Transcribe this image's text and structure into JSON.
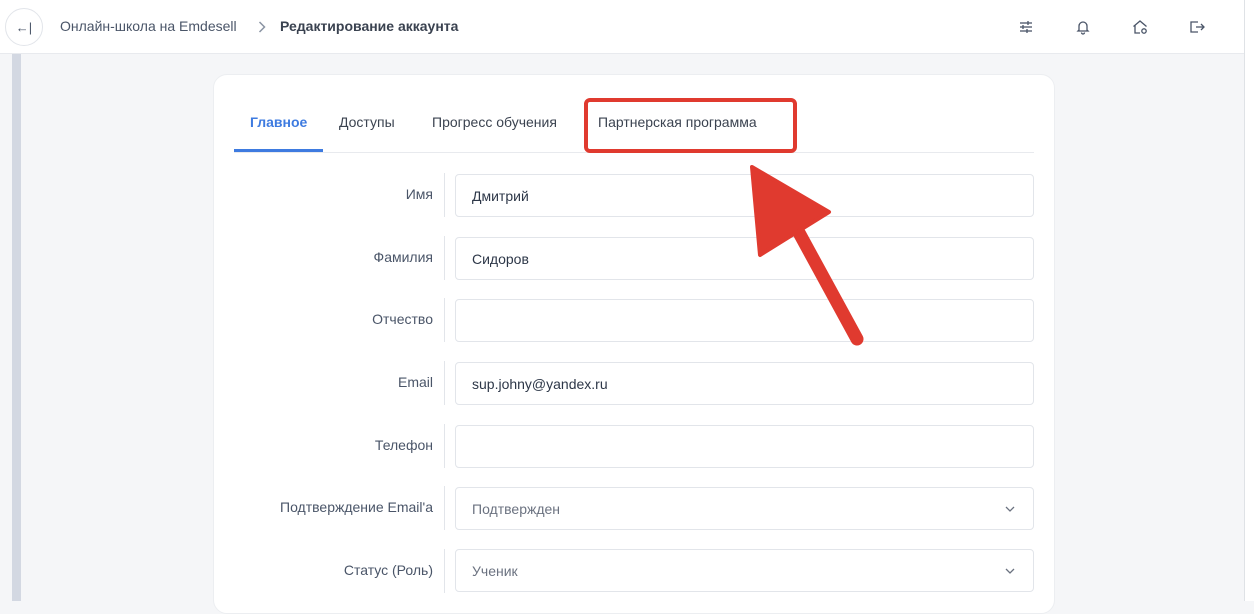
{
  "header": {
    "collapse_glyph": "←|",
    "breadcrumb": {
      "school": "Онлайн-школа на Emdesell",
      "current": "Редактирование аккаунта"
    },
    "icons": [
      "sliders-icon",
      "bell-icon",
      "home-settings-icon",
      "logout-icon"
    ]
  },
  "tabs": [
    {
      "label": "Главное",
      "active": true
    },
    {
      "label": "Доступы",
      "active": false
    },
    {
      "label": "Прогресс обучения",
      "active": false
    },
    {
      "label": "Партнерская программа",
      "active": false,
      "highlighted": true
    }
  ],
  "form": {
    "first_name": {
      "label": "Имя",
      "value": "Дмитрий"
    },
    "last_name": {
      "label": "Фамилия",
      "value": "Сидоров"
    },
    "middle_name": {
      "label": "Отчество",
      "value": ""
    },
    "email": {
      "label": "Email",
      "value": "sup.johny@yandex.ru"
    },
    "phone": {
      "label": "Телефон",
      "value": ""
    },
    "email_confirmation": {
      "label": "Подтверждение Email'a",
      "value": "Подтвержден"
    },
    "role": {
      "label": "Статус (Роль)",
      "value": "Ученик"
    }
  },
  "colors": {
    "accent": "#3e7be0",
    "annotation": "#e03a2f"
  }
}
